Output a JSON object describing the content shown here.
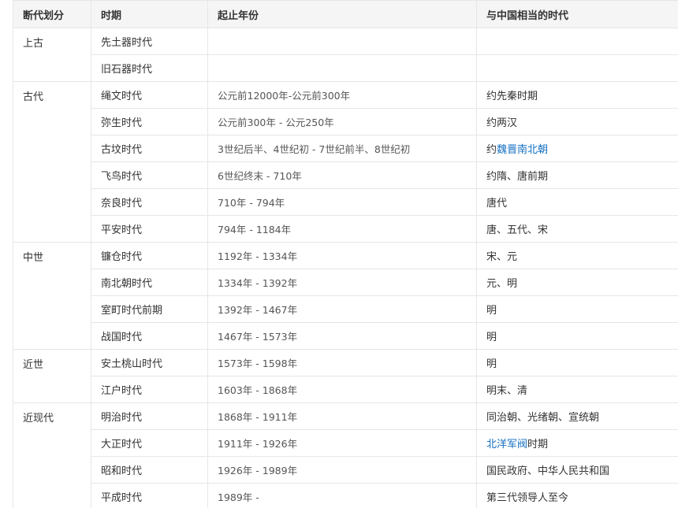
{
  "table": {
    "headers": [
      "断代划分",
      "时期",
      "起止年份",
      "与中国相当的时代"
    ],
    "groups": [
      {
        "period": "上古",
        "rows": [
          {
            "era": "先土器时代",
            "years": "",
            "china": [
              {
                "text": ""
              }
            ]
          },
          {
            "era": "旧石器时代",
            "years": "",
            "china": [
              {
                "text": ""
              }
            ]
          }
        ]
      },
      {
        "period": "古代",
        "rows": [
          {
            "era": "绳文时代",
            "years": "公元前12000年-公元前300年",
            "china": [
              {
                "text": "约先秦时期"
              }
            ]
          },
          {
            "era": "弥生时代",
            "years": "公元前300年 - 公元250年",
            "china": [
              {
                "text": "约两汉"
              }
            ]
          },
          {
            "era": "古坟时代",
            "years": "3世纪后半、4世纪初 - 7世纪前半、8世纪初",
            "china": [
              {
                "text": "约"
              },
              {
                "text": "魏晋南北朝",
                "link": true
              }
            ]
          },
          {
            "era": "飞鸟时代",
            "years": "6世纪终末 - 710年",
            "china": [
              {
                "text": "约隋、唐前期"
              }
            ]
          },
          {
            "era": "奈良时代",
            "years": "710年 - 794年",
            "china": [
              {
                "text": "唐代"
              }
            ]
          },
          {
            "era": "平安时代",
            "years": "794年 - 1184年",
            "china": [
              {
                "text": "唐、五代、宋"
              }
            ]
          }
        ]
      },
      {
        "period": "中世",
        "rows": [
          {
            "era": "镰仓时代",
            "years": "1192年 - 1334年",
            "china": [
              {
                "text": "宋、元"
              }
            ]
          },
          {
            "era": "南北朝时代",
            "years": "1334年 - 1392年",
            "china": [
              {
                "text": "元、明"
              }
            ]
          },
          {
            "era": "室町时代前期",
            "years": "1392年 - 1467年",
            "china": [
              {
                "text": "明"
              }
            ]
          },
          {
            "era": "战国时代",
            "years": "1467年 - 1573年",
            "china": [
              {
                "text": "明"
              }
            ]
          }
        ]
      },
      {
        "period": "近世",
        "rows": [
          {
            "era": "安土桃山时代",
            "years": "1573年 - 1598年",
            "china": [
              {
                "text": "明"
              }
            ]
          },
          {
            "era": "江户时代",
            "years": "1603年 - 1868年",
            "china": [
              {
                "text": "明末、清"
              }
            ]
          }
        ]
      },
      {
        "period": "近现代",
        "rows": [
          {
            "era": "明治时代",
            "years": "1868年 - 1911年",
            "china": [
              {
                "text": "同治朝、光绪朝、宣统朝"
              }
            ]
          },
          {
            "era": "大正时代",
            "years": "1911年 - 1926年",
            "china": [
              {
                "text": "北洋军阀",
                "link": true
              },
              {
                "text": "时期"
              }
            ]
          },
          {
            "era": "昭和时代",
            "years": "1926年 - 1989年",
            "china": [
              {
                "text": "国民政府、中华人民共和国"
              }
            ]
          },
          {
            "era": "平成时代",
            "years": "1989年 -",
            "china": [
              {
                "text": "第三代领导人至今"
              }
            ]
          }
        ]
      }
    ]
  },
  "colors": {
    "text": "#333333",
    "link": "#136ec2",
    "header_bg": "#f5f5f5",
    "border": "#e6e6e6"
  }
}
